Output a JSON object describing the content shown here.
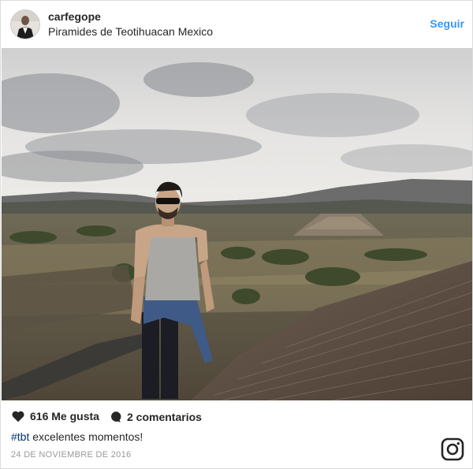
{
  "header": {
    "username": "carfegope",
    "location": "Piramides de Teotihuacan Mexico",
    "follow_label": "Seguir"
  },
  "photo": {
    "description_icon": "photo"
  },
  "stats": {
    "likes_label": "616 Me gusta",
    "comments_label": "2 comentarios"
  },
  "caption": {
    "hashtag": "#tbt",
    "text": " excelentes momentos!"
  },
  "footer": {
    "date": "24 DE NOVIEMBRE DE 2016"
  },
  "colors": {
    "accent": "#3897f0",
    "hashtag": "#003569",
    "text": "#262626",
    "muted": "#999999"
  },
  "icons": {
    "likes": "heart-icon",
    "comments": "comment-bubble-icon",
    "brand": "instagram-icon"
  }
}
